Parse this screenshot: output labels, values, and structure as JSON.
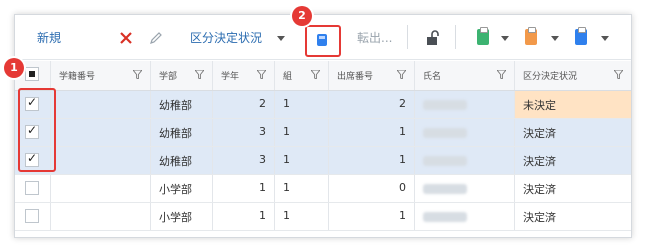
{
  "toolbar": {
    "new_label": "新規",
    "classify_label": "区分決定状況",
    "export_label": "転出...",
    "icons": [
      "close-icon",
      "pencil-icon",
      "calculator-icon",
      "lock-icon",
      "clipboard-icon",
      "clipboard-icon",
      "clipboard-icon"
    ]
  },
  "callouts": {
    "one": "1",
    "two": "2"
  },
  "colors": {
    "accent": "#2b6cb0",
    "highlight": "#e53935",
    "selected_row": "#dfe9f6",
    "pending": "#ffe3c4",
    "clip_green": "#3cb371",
    "clip_orange": "#f2994a",
    "clip_blue": "#2f80ed"
  },
  "table": {
    "headers": [
      "学籍番号",
      "学部",
      "学年",
      "組",
      "出席番号",
      "氏名",
      "区分決定状況"
    ],
    "rows": [
      {
        "checked": true,
        "dept": "幼稚部",
        "grade": "2",
        "class": "1",
        "attendance": "2",
        "status": "未決定",
        "pending": true
      },
      {
        "checked": true,
        "dept": "幼稚部",
        "grade": "3",
        "class": "1",
        "attendance": "1",
        "status": "決定済",
        "pending": false
      },
      {
        "checked": true,
        "dept": "幼稚部",
        "grade": "3",
        "class": "1",
        "attendance": "1",
        "status": "決定済",
        "pending": false
      },
      {
        "checked": false,
        "dept": "小学部",
        "grade": "1",
        "class": "1",
        "attendance": "0",
        "status": "決定済",
        "pending": false
      },
      {
        "checked": false,
        "dept": "小学部",
        "grade": "1",
        "class": "1",
        "attendance": "1",
        "status": "決定済",
        "pending": false
      }
    ]
  }
}
